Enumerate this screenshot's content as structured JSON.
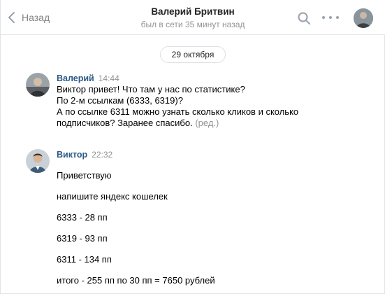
{
  "header": {
    "back_label": "Назад",
    "title": "Валерий Бритвин",
    "status": "был в сети 35 минут назад"
  },
  "date_divider": "29 октября",
  "messages": [
    {
      "author": "Валерий",
      "time": "14:44",
      "lines": [
        "Виктор привет! Что там у нас по статистике?",
        "По 2-м ссылкам (6333, 6319)?",
        "А по ссылке 6311 можно узнать сколько кликов и сколько",
        "подписчиков? Заранее спасибо."
      ],
      "edited_label": "(ред.)"
    },
    {
      "author": "Виктор",
      "time": "22:32",
      "paragraphs": [
        "Приветствую",
        "напишите яндекс кошелек",
        "6333 - 28 пп",
        "6319 - 93 пп",
        "6311 - 134 пп",
        "итого - 255 пп по 30 пп = 7650 рублей"
      ]
    }
  ],
  "icons": {
    "back": "chevron-left-icon",
    "search": "search-icon",
    "more": "more-dots-icon"
  },
  "colors": {
    "author_link": "#2a5885",
    "muted": "#939393",
    "icon": "#99a2ad"
  }
}
